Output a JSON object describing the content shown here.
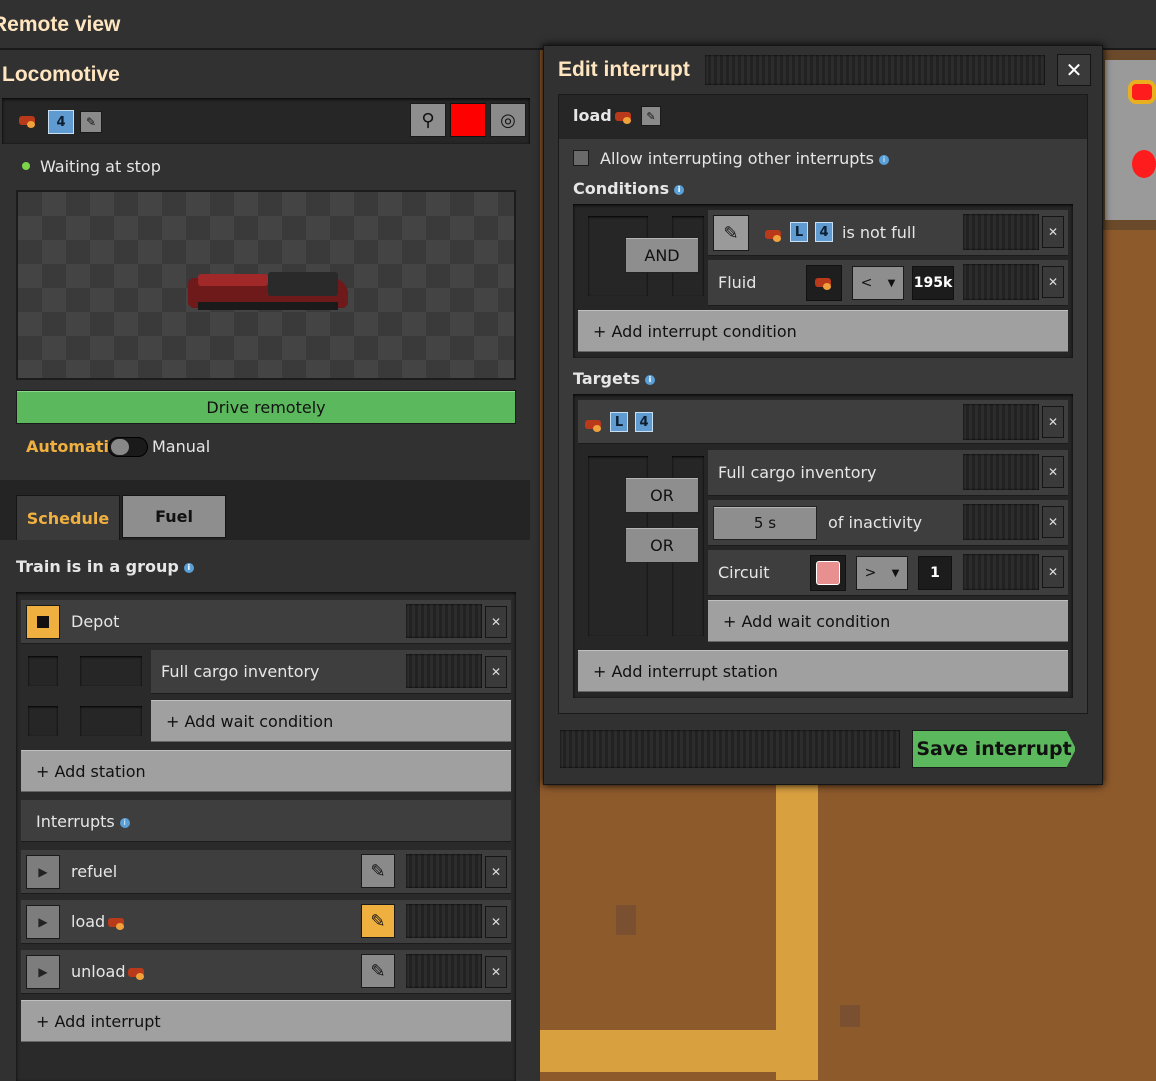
{
  "window": {
    "title": "Remote view"
  },
  "locomotive": {
    "title": "Locomotive",
    "group_number": "4",
    "status": "Waiting at stop",
    "color": "#ff0000",
    "drive_label": "Drive remotely",
    "mode_auto": "Automatic",
    "mode_manual": "Manual",
    "tabs": [
      "Schedule",
      "Fuel"
    ],
    "group_label": "Train is in a group",
    "schedule": {
      "station": "Depot",
      "wait_condition": "Full cargo inventory",
      "add_wait": "+ Add wait condition",
      "add_station": "+ Add station"
    },
    "interrupts_label": "Interrupts",
    "interrupts": [
      "refuel",
      "load",
      "unload"
    ],
    "add_interrupt": "+ Add interrupt"
  },
  "edit_interrupt": {
    "title": "Edit interrupt",
    "name": "load",
    "allow_label": "Allow interrupting other interrupts",
    "conditions_label": "Conditions",
    "and_label": "AND",
    "cond1": {
      "sig1": "L",
      "sig2": "4",
      "text": "is not full"
    },
    "cond2": {
      "label": "Fluid",
      "op": "<",
      "value": "195k"
    },
    "add_condition": "+ Add interrupt condition",
    "targets_label": "Targets",
    "target": {
      "sig1": "L",
      "sig2": "4"
    },
    "or_label": "OR",
    "wait1": "Full cargo inventory",
    "wait2": {
      "time": "5 s",
      "text": "of inactivity"
    },
    "wait3": {
      "label": "Circuit",
      "op": ">",
      "value": "1"
    },
    "add_wait": "+ Add wait condition",
    "add_station": "+ Add interrupt station",
    "save": "Save interrupt"
  }
}
